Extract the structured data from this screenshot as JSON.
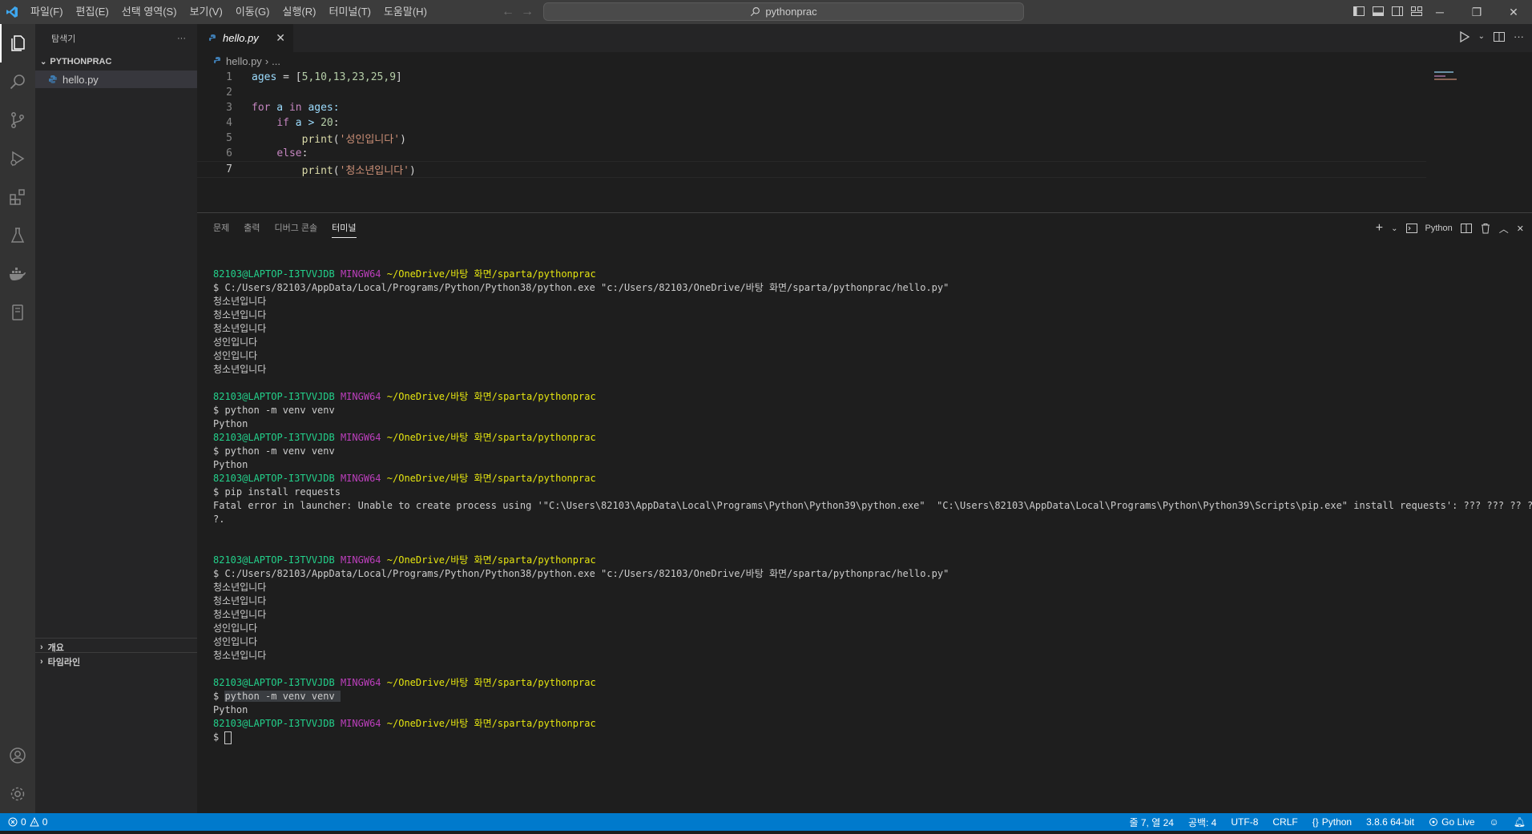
{
  "titlebar": {
    "menu": [
      "파일(F)",
      "편집(E)",
      "선택 영역(S)",
      "보기(V)",
      "이동(G)",
      "실행(R)",
      "터미널(T)",
      "도움말(H)"
    ],
    "search_text": "pythonprac"
  },
  "sidebar": {
    "title": "탐색기",
    "more": "···",
    "folder": "PYTHONPRAC",
    "file": "hello.py",
    "outline": "개요",
    "timeline": "타임라인"
  },
  "editor": {
    "tab_name": "hello.py",
    "breadcrumb_file": "hello.py",
    "breadcrumb_more": "...",
    "line_numbers": [
      "1",
      "2",
      "3",
      "4",
      "5",
      "6",
      "7"
    ],
    "code": {
      "l1_var": "ages",
      "l1_op": " = [",
      "l1_nums": "5,10,13,23,25,9",
      "l1_end": "]",
      "l3_for": "for",
      "l3_a": " a ",
      "l3_in": "in",
      "l3_rest": " ages:",
      "l4_if": "if",
      "l4_rest": " a > ",
      "l4_num": "20",
      "l4_colon": ":",
      "l5_fn": "print",
      "l5_str": "'성인입니다'",
      "l6_else": "else",
      "l6_colon": ":",
      "l7_fn": "print",
      "l7_str": "'청소년입니다'"
    }
  },
  "panel": {
    "tabs": [
      "문제",
      "출력",
      "디버그 콘솔",
      "터미널"
    ],
    "active_tab": "터미널",
    "terminal_name": "Python"
  },
  "terminal": {
    "user": "82103@LAPTOP-I3TVVJDB",
    "host": "MINGW64",
    "path": "~/OneDrive/바탕 화면/sparta/pythonprac",
    "cmd_run": "$ C:/Users/82103/AppData/Local/Programs/Python/Python38/python.exe \"c:/Users/82103/OneDrive/바탕 화면/sparta/pythonprac/hello.py\"",
    "out_teen": "청소년입니다",
    "out_adult": "성인입니다",
    "cmd_venv": "$ python -m venv venv",
    "cmd_venv_prefix": "$ ",
    "cmd_venv_body": "python -m venv venv ",
    "out_python": "Python",
    "cmd_pip": "$ pip install requests",
    "pip_error_1": "Fatal error in launcher: Unable to create process using '\"C:\\Users\\82103\\AppData\\Local\\Programs\\Python\\Python39\\python.exe\"  \"C:\\Users\\82103\\AppData\\Local\\Programs\\Python\\Python39\\Scripts\\pip.exe\" install requests': ??? ??? ?? ? ???",
    "pip_error_2": "?.",
    "prompt": "$ "
  },
  "statusbar": {
    "errors": "0",
    "warnings": "0",
    "position": "줄 7, 열 24",
    "spaces": "공백: 4",
    "encoding": "UTF-8",
    "eol": "CRLF",
    "language": "Python",
    "interpreter": "3.8.6 64-bit",
    "golive": "Go Live"
  },
  "colors": {
    "accent": "#007acc",
    "prompt_user": "#23d18b",
    "prompt_host": "#bc3fbc",
    "prompt_path": "#e5e510"
  }
}
